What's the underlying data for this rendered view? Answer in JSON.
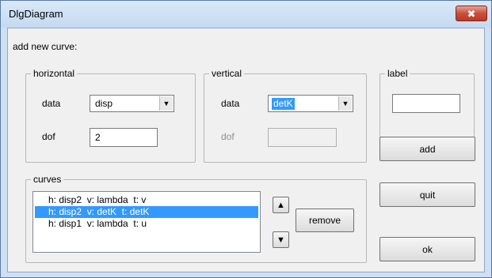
{
  "window": {
    "title": "DlgDiagram",
    "close_glyph": "✖"
  },
  "dialog": {
    "add_new_curve_label": "add new curve:"
  },
  "horizontal": {
    "group_label": "horizontal",
    "data_label": "data",
    "data_value": "disp",
    "dof_label": "dof",
    "dof_value": "2"
  },
  "vertical": {
    "group_label": "vertical",
    "data_label": "data",
    "data_value": "detK",
    "dof_label": "dof",
    "dof_value": ""
  },
  "label_group": {
    "group_label": "label",
    "value": ""
  },
  "curves": {
    "group_label": "curves",
    "items": [
      {
        "text": "h: disp2  v: lambda  t: v",
        "selected": false
      },
      {
        "text": "h: disp2  v: detK  t: detK",
        "selected": true
      },
      {
        "text": "h: disp1  v: lambda  t: u",
        "selected": false
      }
    ],
    "up_glyph": "▲",
    "down_glyph": "▼",
    "remove_label": "remove"
  },
  "buttons": {
    "add_label": "add",
    "quit_label": "quit",
    "ok_label": "ok"
  },
  "icons": {
    "dropdown": "chevron-down-icon",
    "combo_arrow_glyph": "▼",
    "up": "arrow-up-icon",
    "down": "arrow-down-icon",
    "close": "close-icon"
  },
  "colors": {
    "selection": "#3399ff",
    "close_button": "#c8503c",
    "title_bar": "#cfe0f4",
    "dialog_face": "#f0f0f0"
  }
}
